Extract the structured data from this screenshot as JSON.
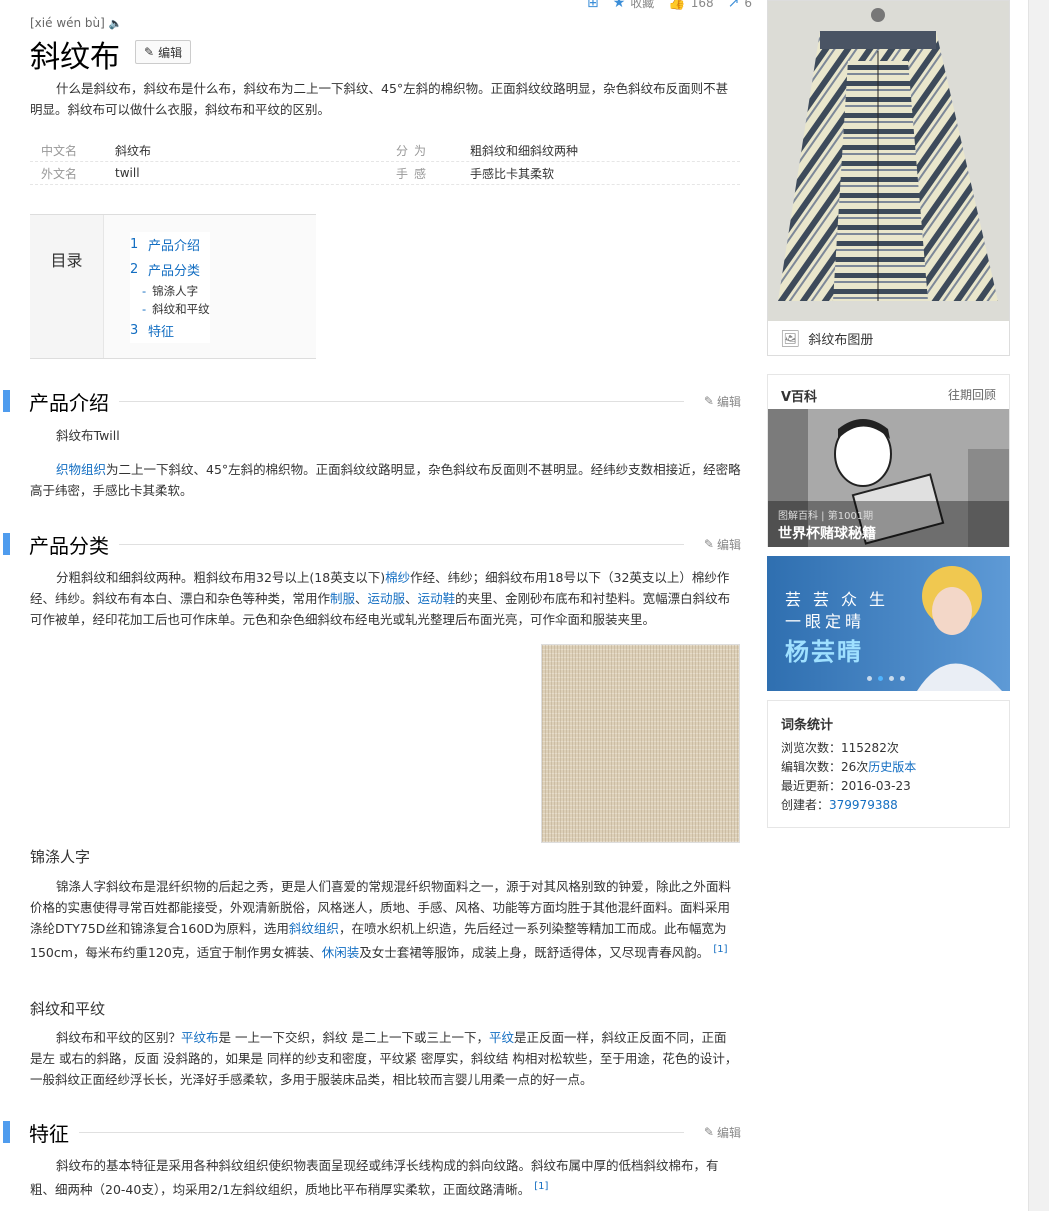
{
  "topbar": {
    "add_label": "",
    "fav_label": "收藏",
    "like_count": "168",
    "share_count": "6"
  },
  "header": {
    "pinyin": "[xié wén bù]",
    "title": "斜纹布",
    "edit_label": "编辑"
  },
  "summary": "什么是斜纹布，斜纹布是什么布，斜纹布为二上一下斜纹、45°左斜的棉织物。正面斜纹纹路明显，杂色斜纹布反面则不甚明显。斜纹布可以做什么衣服，斜纹布和平纹的区别。",
  "basic_info": {
    "rows": [
      {
        "k1": "中文名",
        "v1": "斜纹布",
        "k2": "分为",
        "v2": "粗斜纹和细斜纹两种"
      },
      {
        "k1": "外文名",
        "v1": "twill",
        "k2": "手感",
        "v2": "手感比卡其柔软"
      }
    ]
  },
  "toc": {
    "label": "目录",
    "items": [
      {
        "num": "1",
        "text": "产品介绍"
      },
      {
        "num": "2",
        "text": "产品分类"
      },
      {
        "sub": "锦涤人字"
      },
      {
        "sub": "斜纹和平纹"
      },
      {
        "num": "3",
        "text": "特征"
      }
    ]
  },
  "sections": {
    "intro": {
      "heading": "产品介绍",
      "edit": "编辑",
      "p1": "斜纹布Twill",
      "p2_link": "织物组织",
      "p2_text": "为二上一下斜纹、45°左斜的棉织物。正面斜纹纹路明显，杂色斜纹布反面则不甚明显。经纬纱支数相接近，经密略高于纬密，手感比卡其柔软。"
    },
    "classify": {
      "heading": "产品分类",
      "edit": "编辑",
      "p_a": "分粗斜纹和细斜纹两种。粗斜纹布用32号以上(18英支以下)",
      "p_link1": "棉纱",
      "p_b": "作经、纬纱；细斜纹布用18号以下（32英支以上）棉纱作经、纬纱。斜纹布有本白、漂白和杂色等种类，常用作",
      "p_link2": "制服",
      "p_c": "、",
      "p_link3": "运动服",
      "p_d": "、",
      "p_link4": "运动鞋",
      "p_e": "的夹里、金刚砂布底布和衬垫料。宽幅漂白斜纹布可作被单，经印花加工后也可作床单。元色和杂色细斜纹布经电光或轧光整理后布面光亮，可作伞面和服装夹里。",
      "sub1": "锦涤人字",
      "sub1_a": "锦涤人字斜纹布是混纤织物的后起之秀，更是人们喜爱的常规混纤织物面料之一，源于对其风格别致的钟爱，除此之外面料价格的实惠使得寻常百姓都能接受，外观清新脱俗，风格迷人，质地、手感、风格、功能等方面均胜于其他混纤面料。面料采用涤纶DTY75D丝和锦涤复合160D为原料，选用",
      "sub1_link1": "斜纹组织",
      "sub1_b": "，在喷水织机上织造，先后经过一系列染整等精加工而成。此布幅宽为150cm，每米布约重120克，适宜于制作男女裤装、",
      "sub1_link2": "休闲装",
      "sub1_c": "及女士套裙等服饰，成装上身，既舒适得体，又尽现青春风韵。",
      "sub1_ref": "[1]",
      "sub2": "斜纹和平纹",
      "sub2_a": "斜纹布和平纹的区别？",
      "sub2_link1": "平纹布",
      "sub2_b": "是 一上一下交织，斜纹 是二上一下或三上一下，",
      "sub2_link2": "平纹",
      "sub2_c": "是正反面一样，斜纹正反面不同，正面 是左 或右的斜路，反面 没斜路的，如果是 同样的纱支和密度，平纹紧 密厚实，斜纹结 构相对松软些，至于用途，花色的设计，一般斜纹正面经纱浮长长，光泽好手感柔软，多用于服装床品类，相比较而言婴儿用柔一点的好一点。"
    },
    "feature": {
      "heading": "特征",
      "edit": "编辑",
      "p": "斜纹布的基本特征是采用各种斜纹组织使织物表面呈现经或纬浮长线构成的斜向纹路。斜纹布属中厚的低档斜纹棉布，有粗、细两种（20-40支），均采用2/1左斜纹组织，质地比平布稍厚实柔软，正面纹路清晰。",
      "ref": "[1]"
    }
  },
  "sidebar": {
    "album_caption": "斜纹布图册",
    "vbaike": {
      "title": "V百科",
      "more": "往期回顾",
      "tag": "图解百科 | 第1001期",
      "headline": "世界杯赌球秘籍"
    },
    "ad": {
      "line1": "芸芸众生",
      "line2": "一眼定晴",
      "line3": "杨芸晴"
    },
    "stats": {
      "title": "词条统计",
      "views_label": "浏览次数：",
      "views": "115282次",
      "edits_label": "编辑次数：",
      "edits": "26次",
      "history": "历史版本",
      "updated_label": "最近更新：",
      "updated": "2016-03-23",
      "creator_label": "创建者：",
      "creator": "379979388"
    }
  }
}
